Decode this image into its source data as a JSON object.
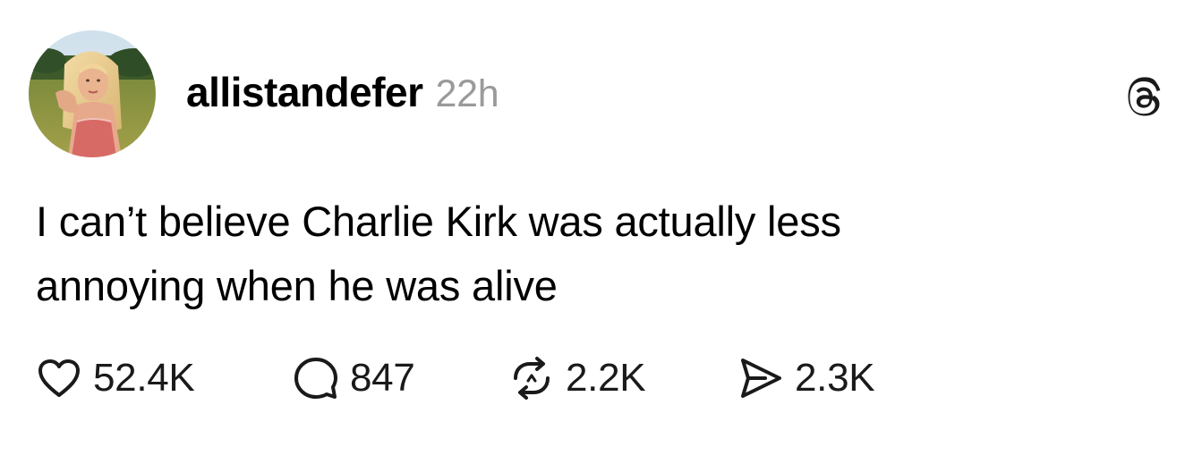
{
  "post": {
    "author": {
      "username": "allistandefer",
      "avatar_icon": "profile-photo-avatar"
    },
    "timestamp": "22h",
    "platform_icon": "threads-logo-icon",
    "text_lines": [
      "I can’t believe Charlie Kirk was actually less",
      "annoying when he was alive"
    ],
    "actions": {
      "likes": {
        "icon": "heart-icon",
        "count": "52.4K"
      },
      "replies": {
        "icon": "comment-bubble-icon",
        "count": "847"
      },
      "reposts": {
        "icon": "repost-icon",
        "count": "2.2K"
      },
      "shares": {
        "icon": "send-icon",
        "count": "2.3K"
      }
    }
  },
  "colors": {
    "background": "#ffffff",
    "text": "#000000",
    "timestamp": "#9a9a9a",
    "icon": "#1a1a1a"
  }
}
